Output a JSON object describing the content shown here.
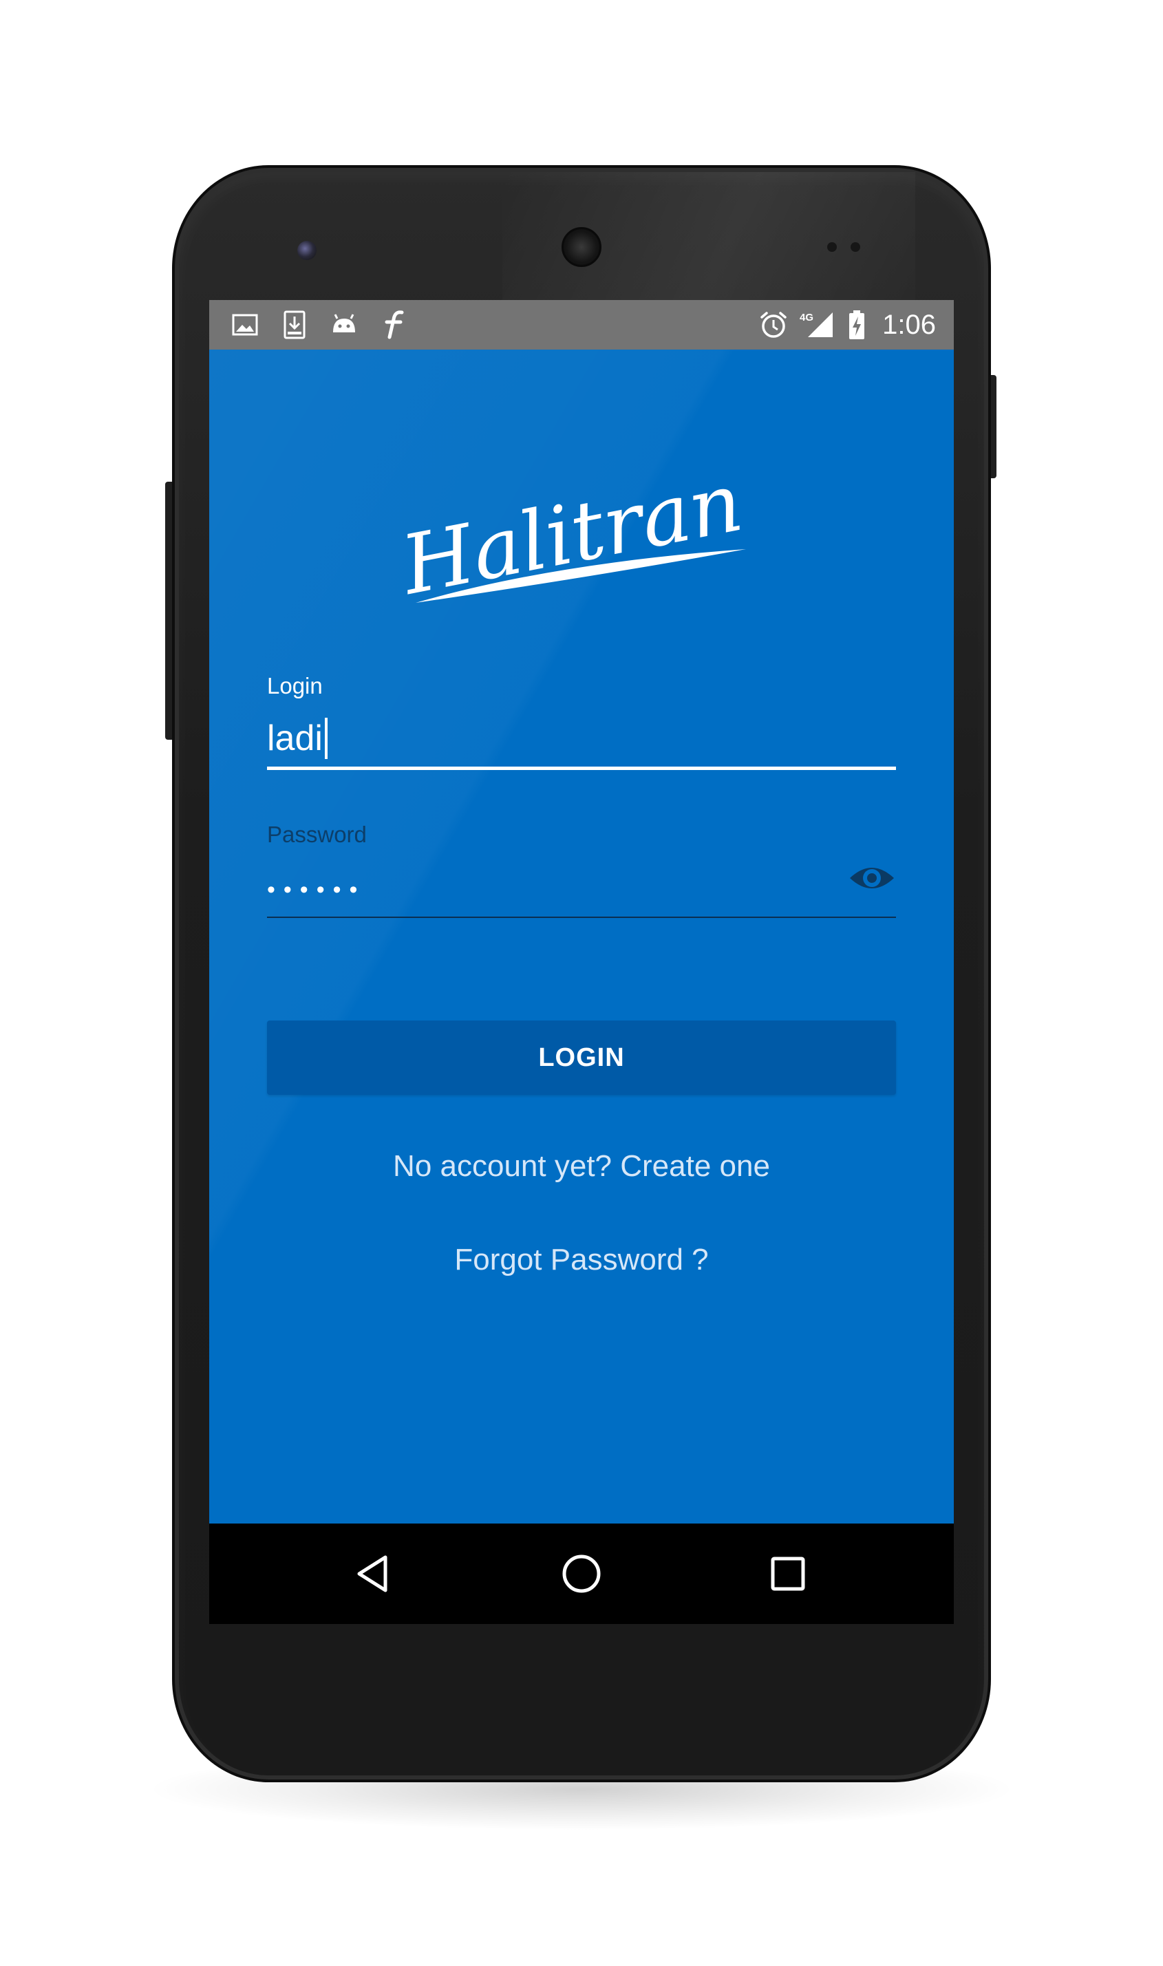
{
  "status_bar": {
    "time": "1:06",
    "network": "4G",
    "left_icons": [
      "gallery-icon",
      "download-icon",
      "android-icon",
      "font-icon"
    ],
    "right_icons": [
      "alarm-icon",
      "signal-icon",
      "battery-charging-icon"
    ]
  },
  "app": {
    "brand": "Halitran",
    "background_color": "#006ec4",
    "login_field": {
      "label": "Login",
      "value": "ladi"
    },
    "password_field": {
      "label": "Password",
      "masked_value": "••••••"
    },
    "login_button": {
      "label": "LOGIN"
    },
    "create_account_link": "No account yet? Create one",
    "forgot_password_link": "Forgot Password ?"
  },
  "nav_bar": {
    "buttons": [
      "back-icon",
      "home-icon",
      "recents-icon"
    ]
  }
}
